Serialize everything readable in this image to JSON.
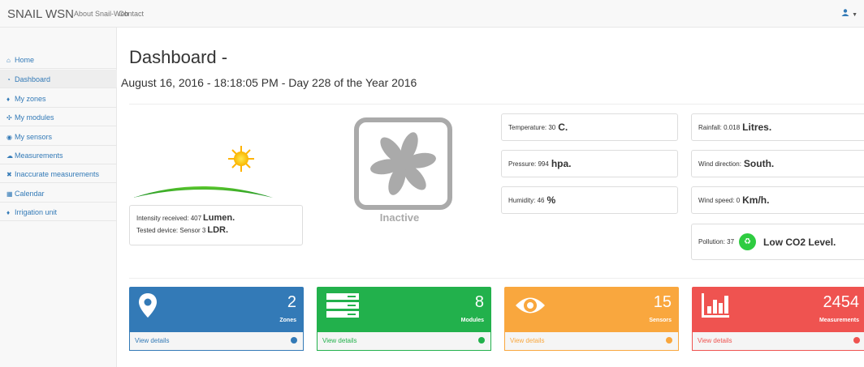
{
  "topbar": {
    "brand": "SNAIL WSN",
    "links": [
      "About Snail-Web",
      "Contact"
    ],
    "user_icon": "user-icon"
  },
  "sidebar": {
    "items": [
      {
        "label": "Home",
        "icon": "home-icon"
      },
      {
        "label": "Dashboard",
        "icon": "dashboard-icon",
        "active": true
      },
      {
        "label": "My zones",
        "icon": "map-marker-icon"
      },
      {
        "label": "My modules",
        "icon": "modules-icon"
      },
      {
        "label": "My sensors",
        "icon": "eye-icon"
      },
      {
        "label": "Measurements",
        "icon": "cloud-icon"
      },
      {
        "label": "Inaccurate measurements",
        "icon": "x-icon"
      },
      {
        "label": "Calendar",
        "icon": "calendar-icon"
      },
      {
        "label": "Irrigation unit",
        "icon": "drop-icon"
      }
    ]
  },
  "main": {
    "title": "Dashboard -",
    "date_line": "August 16, 2016 - 18:18:05 PM - Day 228 of the Year 2016",
    "light": {
      "intensity_label": "Intensity received: 407",
      "intensity_unit": "Lumen.",
      "device_label": "Tested device: Sensor 3",
      "device_unit": "LDR."
    },
    "fan": {
      "status": "Inactive"
    },
    "readings": [
      {
        "label": "Temperature: 30",
        "unit": "C."
      },
      {
        "label": "Pressure: 994",
        "unit": "hpa."
      },
      {
        "label": "Humidity: 46",
        "unit": "%"
      }
    ],
    "readings2": [
      {
        "label": "Rainfall: 0.018",
        "unit": "Litres."
      },
      {
        "label": "Wind direction:",
        "unit": "South."
      },
      {
        "label": "Wind speed: 0",
        "unit": "Km/h."
      }
    ],
    "pollution": {
      "label": "Pollution: 37",
      "text": "Low CO2 Level."
    },
    "cards": [
      {
        "count": "2",
        "label": "Zones",
        "link": "View details",
        "color": "#337ab7",
        "icon": "map-marker-icon"
      },
      {
        "count": "8",
        "label": "Modules",
        "link": "View details",
        "color": "#22b14c",
        "icon": "server-icon"
      },
      {
        "count": "15",
        "label": "Sensors",
        "link": "View details",
        "color": "#f9a73e",
        "icon": "eye-icon"
      },
      {
        "count": "2454",
        "label": "Measurements",
        "link": "View details",
        "color": "#ef5350",
        "icon": "bar-chart-icon"
      }
    ]
  }
}
